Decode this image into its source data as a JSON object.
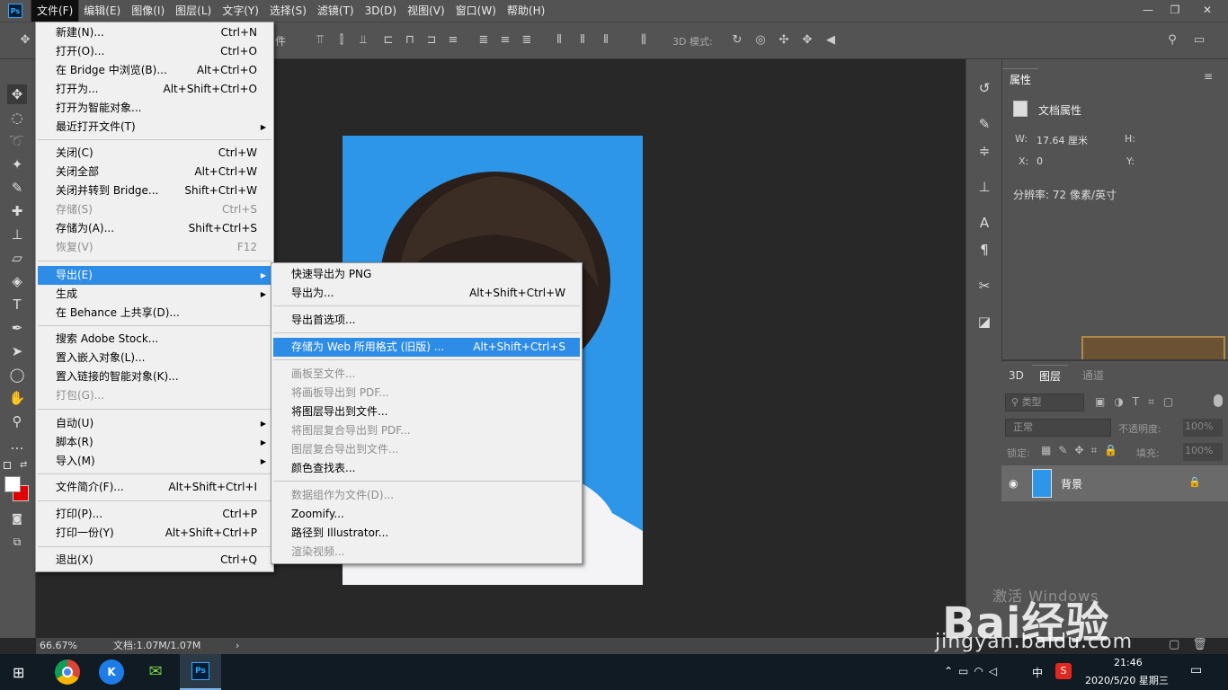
{
  "app": {
    "logo": "Ps"
  },
  "menubar": [
    "文件(F)",
    "编辑(E)",
    "图像(I)",
    "图层(L)",
    "文字(Y)",
    "选择(S)",
    "滤镜(T)",
    "3D(D)",
    "视图(V)",
    "窗口(W)",
    "帮助(H)"
  ],
  "optbar": {
    "label_3d": "3D 模式:",
    "frag": "件"
  },
  "file_menu": [
    {
      "label": "新建(N)...",
      "sc": "Ctrl+N"
    },
    {
      "label": "打开(O)...",
      "sc": "Ctrl+O"
    },
    {
      "label": "在 Bridge 中浏览(B)...",
      "sc": "Alt+Ctrl+O"
    },
    {
      "label": "打开为...",
      "sc": "Alt+Shift+Ctrl+O"
    },
    {
      "label": "打开为智能对象...",
      "sc": ""
    },
    {
      "label": "最近打开文件(T)",
      "sc": ""
    },
    {
      "label": "关闭(C)",
      "sc": "Ctrl+W"
    },
    {
      "label": "关闭全部",
      "sc": "Alt+Ctrl+W"
    },
    {
      "label": "关闭并转到 Bridge...",
      "sc": "Shift+Ctrl+W"
    },
    {
      "label": "存储(S)",
      "sc": "Ctrl+S"
    },
    {
      "label": "存储为(A)...",
      "sc": "Shift+Ctrl+S"
    },
    {
      "label": "恢复(V)",
      "sc": "F12"
    },
    {
      "label": "导出(E)",
      "sc": ""
    },
    {
      "label": "生成",
      "sc": ""
    },
    {
      "label": "在 Behance 上共享(D)...",
      "sc": ""
    },
    {
      "label": "搜索 Adobe Stock...",
      "sc": ""
    },
    {
      "label": "置入嵌入对象(L)...",
      "sc": ""
    },
    {
      "label": "置入链接的智能对象(K)...",
      "sc": ""
    },
    {
      "label": "打包(G)...",
      "sc": ""
    },
    {
      "label": "自动(U)",
      "sc": ""
    },
    {
      "label": "脚本(R)",
      "sc": ""
    },
    {
      "label": "导入(M)",
      "sc": ""
    },
    {
      "label": "文件简介(F)...",
      "sc": "Alt+Shift+Ctrl+I"
    },
    {
      "label": "打印(P)...",
      "sc": "Ctrl+P"
    },
    {
      "label": "打印一份(Y)",
      "sc": "Alt+Shift+Ctrl+P"
    },
    {
      "label": "退出(X)",
      "sc": "Ctrl+Q"
    }
  ],
  "export_menu": [
    {
      "label": "快速导出为 PNG",
      "sc": ""
    },
    {
      "label": "导出为...",
      "sc": "Alt+Shift+Ctrl+W"
    },
    {
      "label": "导出首选项...",
      "sc": ""
    },
    {
      "label": "存储为 Web 所用格式 (旧版) ...",
      "sc": "Alt+Shift+Ctrl+S"
    },
    {
      "label": "画板至文件...",
      "sc": ""
    },
    {
      "label": "将画板导出到 PDF...",
      "sc": ""
    },
    {
      "label": "将图层导出到文件...",
      "sc": ""
    },
    {
      "label": "将图层复合导出到 PDF...",
      "sc": ""
    },
    {
      "label": "图层复合导出到文件...",
      "sc": ""
    },
    {
      "label": "颜色查找表...",
      "sc": ""
    },
    {
      "label": "数据组作为文件(D)...",
      "sc": ""
    },
    {
      "label": "Zoomify...",
      "sc": ""
    },
    {
      "label": "路径到 Illustrator...",
      "sc": ""
    },
    {
      "label": "渲染视频...",
      "sc": ""
    }
  ],
  "properties": {
    "tab": "属性",
    "section": "文档属性",
    "w_label": "W:",
    "w_value": "17.64 厘米",
    "h_label": "H:",
    "x_label": "X:",
    "x_value": "0",
    "y_label": "Y:",
    "resolution": "分辨率: 72 像素/英寸"
  },
  "layers": {
    "tab_3d": "3D",
    "tab_layers": "图层",
    "tab_partial": "通道",
    "filter": "类型",
    "blend": "正常",
    "opacity_label": "不透明度:",
    "opacity": "100%",
    "lock_label": "锁定:",
    "fill_label": "填充:",
    "fill": "100%",
    "layer_name": "背景"
  },
  "status": {
    "zoom": "66.67%",
    "doc": "文档:1.07M/1.07M"
  },
  "taskbar": {
    "time": "21:46",
    "date": "2020/5/20 星期三",
    "ime": "中"
  },
  "watermark": {
    "brand": "Bai经验",
    "url": "jingyan.baidu.com",
    "activate": "激活 Windows"
  }
}
